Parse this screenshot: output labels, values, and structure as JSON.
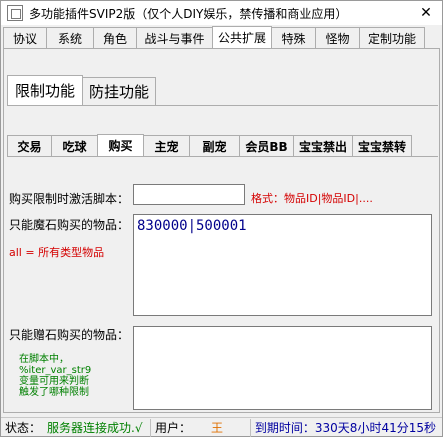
{
  "window": {
    "title": "多功能插件SVIP2版（仅个人DIY娱乐，禁传播和商业应用）",
    "close_glyph": "✕"
  },
  "top_tabs": [
    {
      "label": "协议",
      "active": false
    },
    {
      "label": "系统",
      "active": false
    },
    {
      "label": "角色",
      "active": false
    },
    {
      "label": "战斗与事件",
      "active": false
    },
    {
      "label": "公共扩展",
      "active": true
    },
    {
      "label": "特殊",
      "active": false
    },
    {
      "label": "怪物",
      "active": false
    },
    {
      "label": "定制功能",
      "active": false
    }
  ],
  "level2_tabs": [
    {
      "label": "限制功能",
      "active": true
    },
    {
      "label": "防挂功能",
      "active": false
    }
  ],
  "level3_tabs": [
    {
      "label": "交易",
      "active": false
    },
    {
      "label": "吃球",
      "active": false
    },
    {
      "label": "购买",
      "active": true
    },
    {
      "label": "主宠",
      "active": false
    },
    {
      "label": "副宠",
      "active": false
    },
    {
      "label": "会员BB",
      "active": false
    },
    {
      "label": "宝宝禁出",
      "active": false
    },
    {
      "label": "宝宝禁转",
      "active": false
    }
  ],
  "form": {
    "limit_script_label": "购买限制时激活脚本：",
    "limit_script_value": "",
    "format_hint": "格式：物品ID|物品ID|....",
    "magic_stone_label": "只能魔石购买的物品：",
    "magic_stone_value": "830000|500001",
    "all_hint": "all = 所有类型物品",
    "gift_stone_label": "只能赠石购买的物品：",
    "gift_stone_value": "",
    "green_note": [
      "在脚本中，",
      "%iter_var_str9",
      "变量可用来判断",
      "触发了哪种限制"
    ]
  },
  "statusbar": {
    "state_label": "状态：",
    "state_value": "服务器连接成功.√",
    "user_label": "用户：",
    "user_value": "王",
    "expire_label": "到期时间：",
    "expire_value": "330天8小时41分15秒",
    "colors": {
      "state": "#008000",
      "user": "#e07000",
      "expire": "#0000a0"
    }
  }
}
